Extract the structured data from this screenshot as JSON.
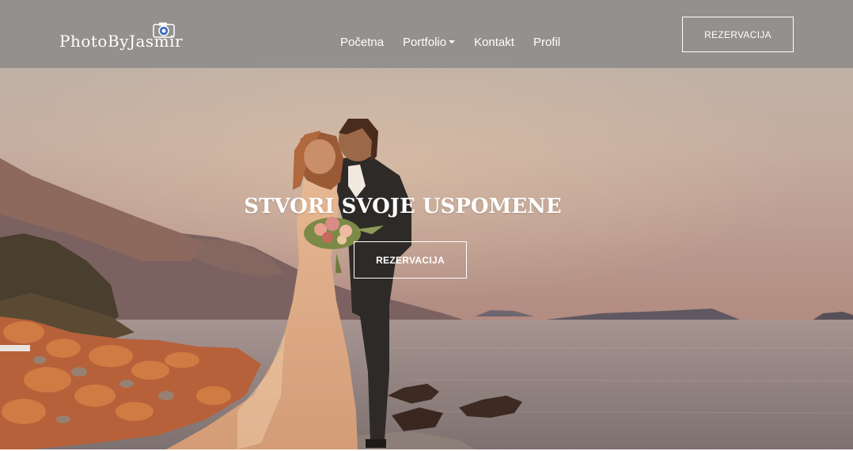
{
  "header": {
    "logo_text": "PhotoByJasmir",
    "nav": [
      {
        "label": "Početna"
      },
      {
        "label": "Portfolio"
      },
      {
        "label": "Kontakt"
      },
      {
        "label": "Profil"
      }
    ],
    "cta_label": "REZERVACIJA"
  },
  "hero": {
    "title": "STVORI SVOJE USPOMENE",
    "cta_label": "REZERVACIJA"
  },
  "icons": {
    "logo": "camera-icon",
    "portfolio_dropdown": "caret-down-icon"
  },
  "colors": {
    "navbar_background": "#878787",
    "text": "#ffffff",
    "sky_top": "#b9b2a8",
    "sky_bottom": "#b58f82",
    "sea": "#8c7e7c",
    "rocks": "#c76b3a"
  }
}
